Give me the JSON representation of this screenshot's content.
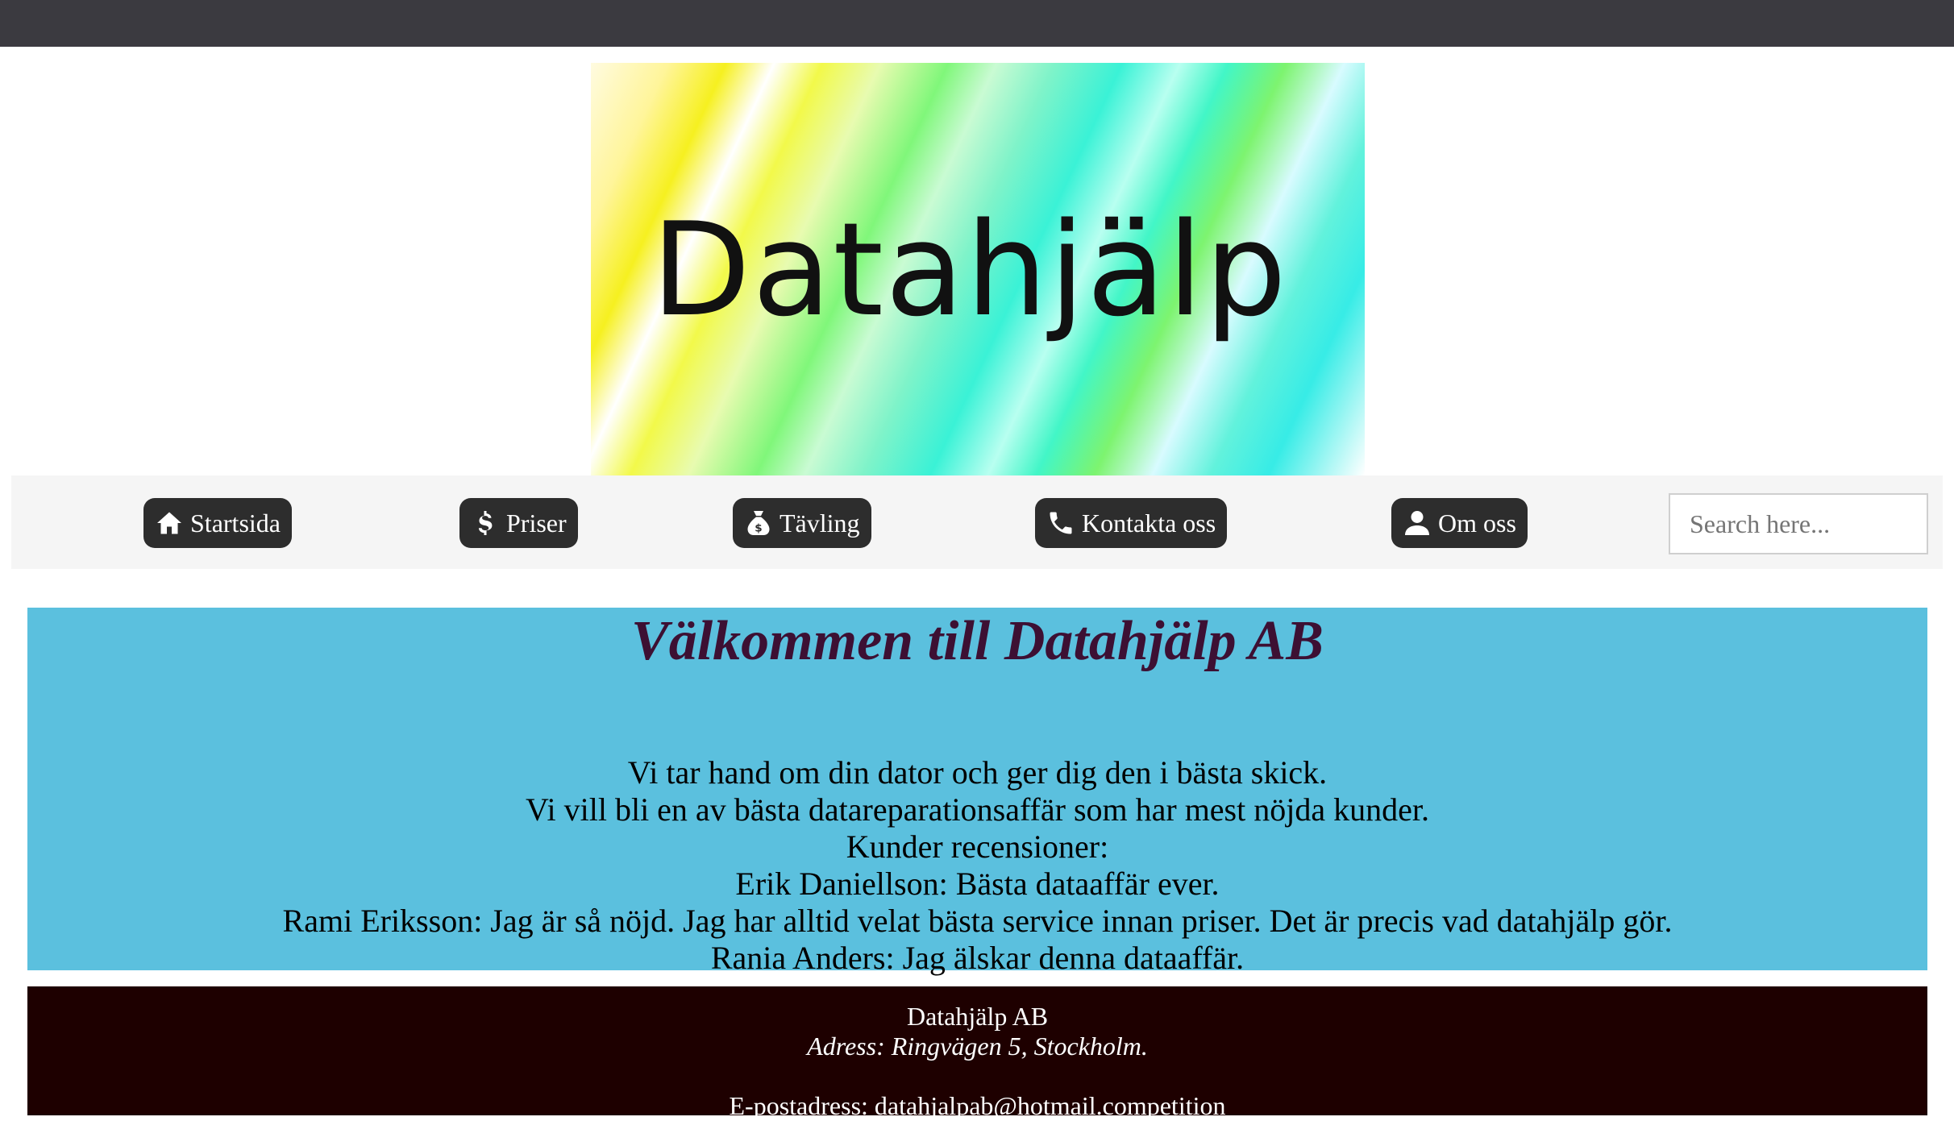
{
  "banner": {
    "text": "Datahjälp"
  },
  "nav": {
    "items": [
      {
        "label": "Startsida",
        "icon": "home-icon"
      },
      {
        "label": "Priser",
        "icon": "dollar-icon"
      },
      {
        "label": "Tävling",
        "icon": "money-bag-icon"
      },
      {
        "label": "Kontakta oss",
        "icon": "phone-icon"
      },
      {
        "label": "Om oss",
        "icon": "user-icon"
      }
    ],
    "search_placeholder": "Search here..."
  },
  "welcome": {
    "title": "Välkommen till Datahjälp AB",
    "lines": [
      "Vi tar hand om din dator och ger dig den i bästa skick.",
      "Vi vill bli en av bästa datareparationsaffär som har mest nöjda kunder.",
      "Kunder recensioner:",
      "Erik Daniellson: Bästa dataaffär ever.",
      "Rami Eriksson: Jag är så nöjd. Jag har alltid velat bästa service innan priser. Det är precis vad datahjälp gör.",
      "Rania Anders: Jag älskar denna dataaffär."
    ]
  },
  "footer": {
    "company": "Datahjälp AB",
    "address": "Adress: Ringvägen 5, Stockholm.",
    "email": "E-postadress: datahjalpab@hotmail.competition"
  },
  "colors": {
    "topbar": "#3b3a40",
    "nav_button": "#2d2d2d",
    "welcome_bg": "#5bc0de",
    "welcome_title": "#3d1033",
    "footer_bg": "#1e0000"
  }
}
